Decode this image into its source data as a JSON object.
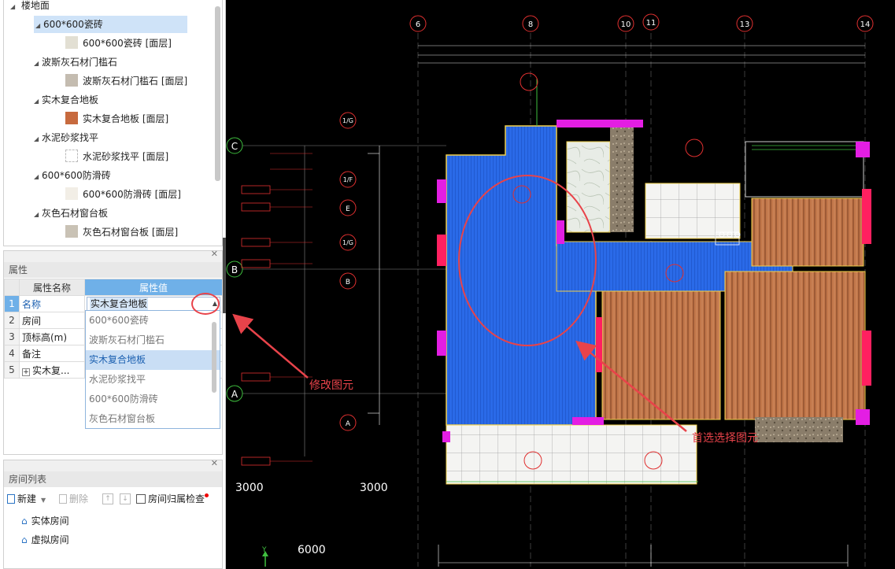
{
  "tree": {
    "root": "楼地面",
    "groups": [
      {
        "name": "600*600瓷砖",
        "child": "600*600瓷砖 [面层]",
        "swatch": "#e2dfd3"
      },
      {
        "name": "波斯灰石材门槛石",
        "child": "波斯灰石材门槛石 [面层]",
        "swatch": "#c4bcb0"
      },
      {
        "name": "实木复合地板",
        "child": "实木复合地板 [面层]",
        "swatch": "#c76a3e"
      },
      {
        "name": "水泥砂浆找平",
        "child": "水泥砂浆找平 [面层]",
        "swatch": "#ffffff"
      },
      {
        "name": "600*600防滑砖",
        "child": "600*600防滑砖 [面层]",
        "swatch": "#f2eee6"
      },
      {
        "name": "灰色石材窗台板",
        "child": "灰色石材窗台板 [面层]",
        "swatch": "#c9c2b5"
      }
    ]
  },
  "properties": {
    "title": "属性",
    "col_name": "属性名称",
    "col_value": "属性值",
    "rows": [
      {
        "num": "1",
        "name": "名称",
        "value": "实木复合地板"
      },
      {
        "num": "2",
        "name": "房间",
        "value": ""
      },
      {
        "num": "3",
        "name": "顶标高(m)",
        "value": ""
      },
      {
        "num": "4",
        "name": "备注",
        "value": ""
      },
      {
        "num": "5",
        "name": "实木复...",
        "value": ""
      }
    ],
    "dropdown_options": [
      "600*600瓷砖",
      "波斯灰石材门槛石",
      "实木复合地板",
      "水泥砂浆找平",
      "600*600防滑砖",
      "灰色石材窗台板"
    ],
    "dropdown_selected": "实木复合地板"
  },
  "room_list": {
    "title": "房间列表",
    "new_label": "新建",
    "delete_label": "删除",
    "check_label": "房间归属检查",
    "items": [
      "实体房间",
      "虚拟房间"
    ]
  },
  "cad": {
    "axis_top": [
      "6",
      "8",
      "10",
      "11",
      "13",
      "14"
    ],
    "axis_left_circles": [
      "1/G",
      "1/F",
      "E",
      "1/G",
      "B",
      "A"
    ],
    "grid_rows": [
      "C",
      "B",
      "A"
    ],
    "dims": [
      "3000",
      "3000",
      "6000"
    ],
    "annotation_modify": "修改图元",
    "annotation_select": "首选选择图元",
    "ucs_label": "Y"
  },
  "colors": {
    "accent": "#6fb0e8",
    "annotation": "#e8434a",
    "blue_fill": "#2a6ae8",
    "wood": "#c2774a",
    "magenta": "#e31ee3"
  }
}
